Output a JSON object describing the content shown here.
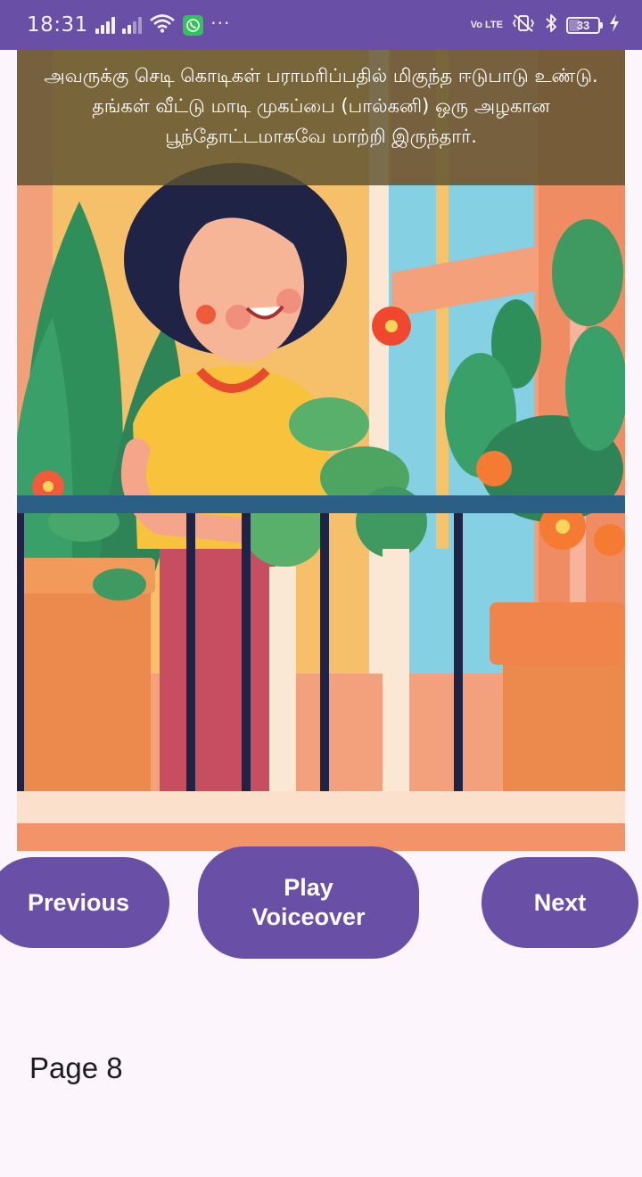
{
  "status_bar": {
    "time": "18:31",
    "network_label": "Vo LTE",
    "battery_level": "33",
    "icons": [
      "signal-icon",
      "signal-no-data-icon",
      "wifi-icon",
      "whatsapp-icon",
      "more-dots-icon",
      "volte-icon",
      "vibrate-icon",
      "bluetooth-icon",
      "battery-icon",
      "charging-icon"
    ]
  },
  "story": {
    "caption": "அவருக்கு செடி கொடிகள் பராமரிப்பதில் மிகுந்த ஈடுபாடு உண்டு. தங்கள் வீட்டு மாடி முகப்பை (பால்கனி) ஒரு அழகான பூந்தோட்டமாகவே மாற்றி இருந்தார்.",
    "image_subject": "woman tending flowering plants on a balcony"
  },
  "controls": {
    "previous_label": "Previous",
    "play_label": "Play Voiceover",
    "next_label": "Next"
  },
  "page": {
    "label": "Page 8"
  },
  "colors": {
    "accent": "#6a4fa6",
    "background": "#fcf5fc",
    "caption_overlay": "#5c5230"
  }
}
